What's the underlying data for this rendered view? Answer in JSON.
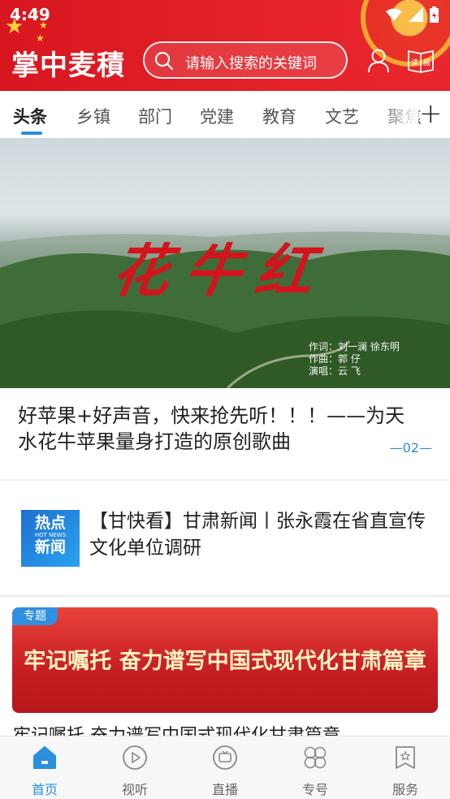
{
  "status": {
    "time": "4:49"
  },
  "header": {
    "app_title": "掌中麦積",
    "search_placeholder": "请输入搜索的关键词"
  },
  "tabs": [
    {
      "label": "头条",
      "active": true
    },
    {
      "label": "乡镇",
      "active": false
    },
    {
      "label": "部门",
      "active": false
    },
    {
      "label": "党建",
      "active": false
    },
    {
      "label": "教育",
      "active": false
    },
    {
      "label": "文艺",
      "active": false
    },
    {
      "label": "聚焦",
      "active": false
    }
  ],
  "hero": {
    "image_title": "花牛红",
    "credits": [
      "作词：刘一澜 徐东明",
      "作曲：郭 仔",
      "演唱：云 飞"
    ],
    "headline": "好苹果+好声音，快来抢先听！！！——为天水花牛苹果量身打造的原创歌曲",
    "pager": "—02—"
  },
  "news": {
    "thumb_line1": "热点",
    "thumb_line2": "HOT NEWS",
    "thumb_line3": "新闻",
    "title": "【甘快看】甘肃新闻丨张永霞在省直宣传文化单位调研"
  },
  "topic": {
    "tag": "专题",
    "banner_text": "牢记嘱托 奋力谱写中国式现代化甘肃篇章",
    "caption": "牢记嘱托 奋力谱写中国式现代化甘肃篇章"
  },
  "bottom_nav": [
    {
      "label": "首页",
      "icon": "home-icon",
      "active": true
    },
    {
      "label": "视听",
      "icon": "play-icon",
      "active": false
    },
    {
      "label": "直播",
      "icon": "tv-icon",
      "active": false
    },
    {
      "label": "专号",
      "icon": "grid-icon",
      "active": false
    },
    {
      "label": "服务",
      "icon": "bookmark-icon",
      "active": false
    }
  ],
  "colors": {
    "brand_red": "#d8161f",
    "accent_blue": "#2a8fdc"
  }
}
